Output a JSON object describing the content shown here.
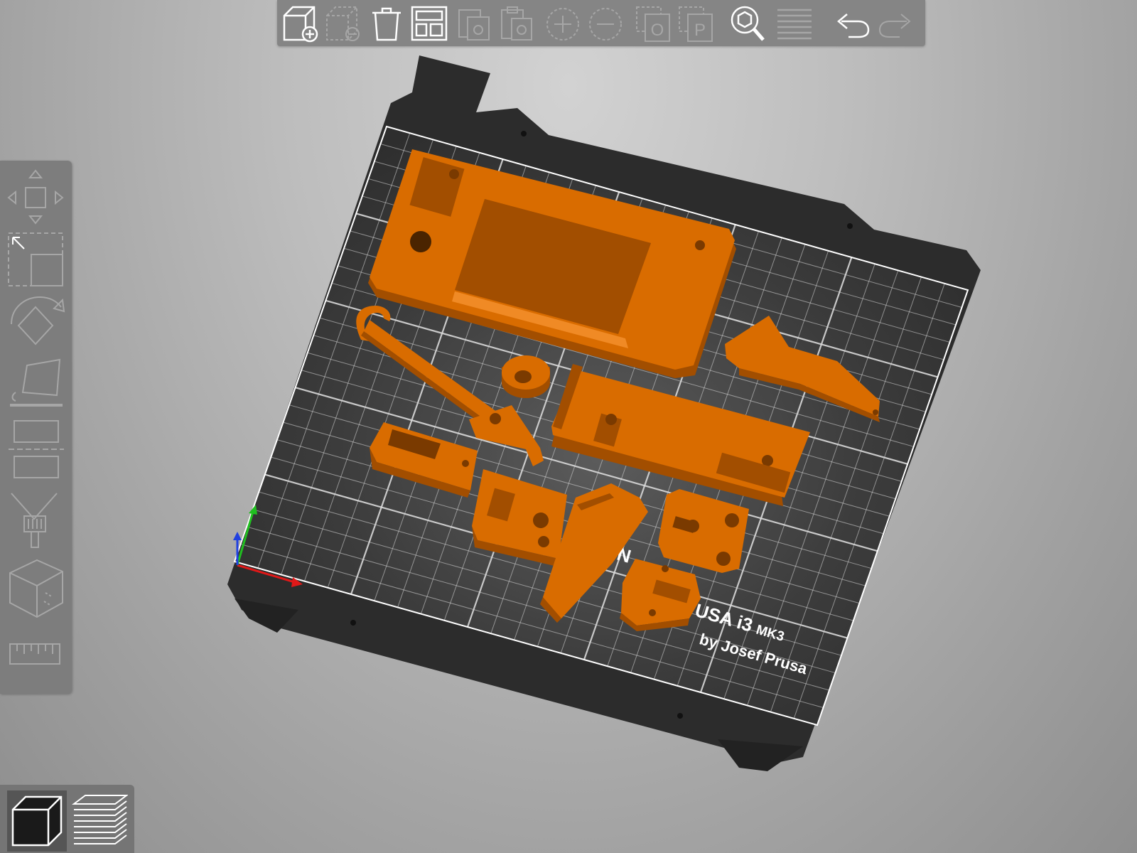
{
  "app": {
    "name": "PrusaSlicer-style 3D plater"
  },
  "toolbar": {
    "buttons": [
      {
        "name": "add",
        "icon": "add-object-icon",
        "enabled": true
      },
      {
        "name": "delete",
        "icon": "delete-icon",
        "enabled": false
      },
      {
        "name": "delete-all",
        "icon": "trash-icon",
        "enabled": true
      },
      {
        "name": "arrange",
        "icon": "arrange-icon",
        "enabled": true
      },
      {
        "name": "copy",
        "icon": "copy-icon",
        "enabled": false
      },
      {
        "name": "paste",
        "icon": "paste-icon",
        "enabled": false
      },
      {
        "name": "add-instance",
        "icon": "plus-circle-icon",
        "enabled": false
      },
      {
        "name": "remove-instance",
        "icon": "minus-circle-icon",
        "enabled": false
      },
      {
        "name": "split-objects",
        "icon": "split-objects-icon",
        "enabled": false
      },
      {
        "name": "split-parts",
        "icon": "split-parts-icon",
        "enabled": false
      },
      {
        "name": "search",
        "icon": "search-icon",
        "enabled": true
      },
      {
        "name": "layers-editing",
        "icon": "layers-editing-icon",
        "enabled": false
      },
      {
        "name": "undo",
        "icon": "undo-icon",
        "enabled": true
      },
      {
        "name": "redo",
        "icon": "redo-icon",
        "enabled": false
      }
    ],
    "split_objects_glyph": "O",
    "split_parts_glyph": "P"
  },
  "gizmos": [
    {
      "name": "move",
      "icon": "move-icon"
    },
    {
      "name": "scale",
      "icon": "scale-icon"
    },
    {
      "name": "rotate",
      "icon": "rotate-icon"
    },
    {
      "name": "place-on-face",
      "icon": "place-on-face-icon"
    },
    {
      "name": "cut",
      "icon": "cut-icon"
    },
    {
      "name": "paint-supports",
      "icon": "paint-brush-icon"
    },
    {
      "name": "seam",
      "icon": "cube-seam-icon"
    },
    {
      "name": "measure",
      "icon": "ruler-icon"
    }
  ],
  "views": [
    {
      "name": "3d-view",
      "icon": "cube-view-icon",
      "active": true
    },
    {
      "name": "preview",
      "icon": "layers-preview-icon",
      "active": false
    }
  ],
  "bed": {
    "label_line1_left": "IGIN",
    "label_line1_right": "USA i3",
    "label_model": "MK3",
    "label_line2": "by Josef Prusa"
  },
  "colors": {
    "object": "#d96c00",
    "object_shade": "#a24e00",
    "object_highlight": "#f08a25",
    "bed": "#2e2e2e",
    "grid": "#e8e8e8",
    "axis_x": "#e01818",
    "axis_y": "#20c020",
    "axis_z": "#2040e0"
  }
}
